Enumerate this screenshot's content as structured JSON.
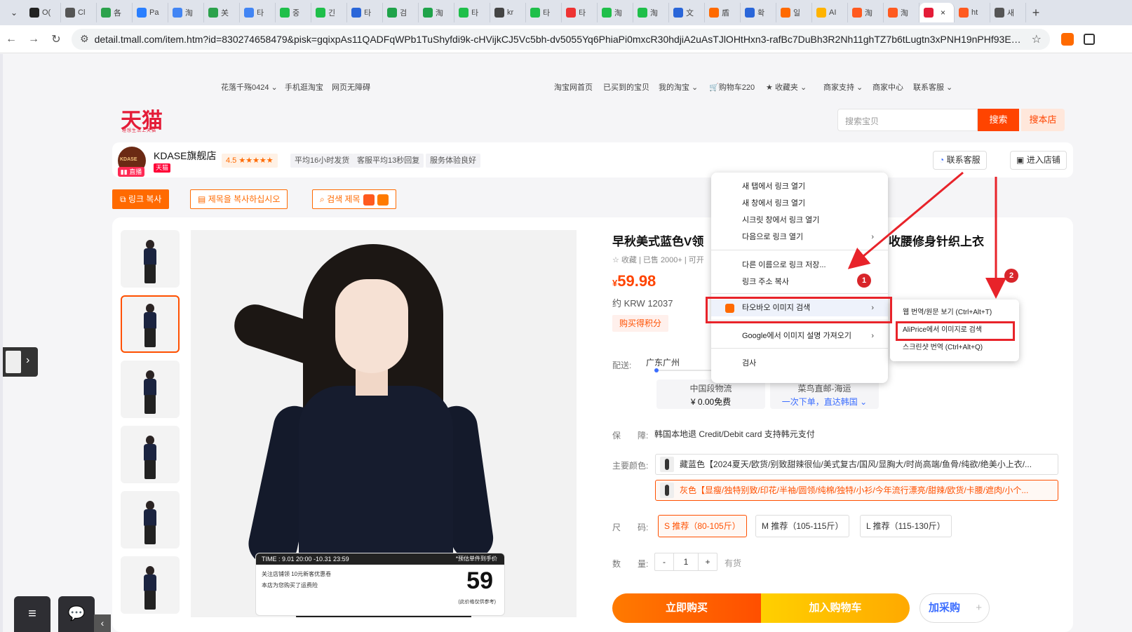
{
  "browser": {
    "tabs": [
      "O(",
      "Cl",
      "各",
      "Pa",
      "淘",
      "关",
      "타",
      "중",
      "긴",
      "타",
      "검",
      "淘",
      "타",
      "kr",
      "타",
      "타",
      "淘",
      "淘",
      "文",
      "盾",
      "확",
      "일",
      "AI",
      "淘",
      "淘",
      "",
      "ht",
      "새"
    ],
    "active_tab_close": "×",
    "new_tab": "+",
    "url": "detail.tmall.com/item.htm?id=830274658479&pisk=gqixpAs11QADFqWPb1TuShyfdi9k-cHVijkCJ5Vc5bh-dv5055Yq6PhiaPi0mxcR30hdjiA2uAsTJlOHtHxn3-rafBc7DuBh3R2Nh11ghTZ7b6tLugtn3xPNH19nPHf93ECAlNNs1ua7CJZ_hZ..."
  },
  "site_nav": {
    "user": "花落千殇0424",
    "mobile": "手机逛淘宝",
    "accessible": "网页无障碍",
    "home": "淘宝网首页",
    "bought": "已买到的宝贝",
    "my_taobao": "我的淘宝",
    "cart": "购物车220",
    "favorites": "收藏夹",
    "merchant_support": "商家支持",
    "merchant_center": "商家中心",
    "customer_service": "联系客服"
  },
  "header": {
    "logo": "天猫",
    "logo_sub": "理想生活上天猫",
    "search_placeholder": "搜索宝贝",
    "search_btn": "搜索",
    "search_store_btn": "搜本店"
  },
  "shop": {
    "avatar_text": "KDASE",
    "live": "直播",
    "name": "KDASE旗舰店",
    "tmall": "天猫",
    "rating": "4.5 ★★★★★",
    "tags": [
      "平均16小时发货",
      "客服平均13秒回复",
      "服务体验良好"
    ],
    "contact": "联系客服",
    "enter": "进入店铺"
  },
  "ext_buttons": {
    "copy_link": "링크 복사",
    "copy_title": "제목을 복사하십시오",
    "search_title": "검색 제목"
  },
  "product": {
    "title": "早秋美式蓝色V领",
    "title_tail": "收腰修身针织上衣",
    "meta": "☆ 收藏 | 已售 2000+ | 可开",
    "price_yen": "¥",
    "price": "59.98",
    "krw": "约 KRW 12037",
    "points": "购买得积分",
    "ship_label": "配送:",
    "ship_loc": "广东广州",
    "ship_cards": [
      {
        "a": "中国段物流",
        "b": "¥ 0.00免费"
      },
      {
        "a": "菜鸟直邮-海运",
        "b": "一次下单，直达韩国 ⌄"
      }
    ],
    "guarantee_label": "保　　障:",
    "guarantee": "韩国本地退 Credit/Debit card 支持韩元支付",
    "color_label": "主要颜色:",
    "colors": [
      "藏蓝色【2024夏天/欧货/别致甜辣很仙/美式复古/国风/显胸大/时尚高端/鱼骨/纯欲/绝美小上衣/...",
      "灰色【显瘦/独特别致/印花/半袖/圆领/纯棉/独特/小衫/今年流行漂亮/甜辣/欧货/卡腰/遮肉/小个..."
    ],
    "size_label": "尺　　码:",
    "sizes": [
      "S 推荐（80-105斤）",
      "M 推荐（105-115斤）",
      "L 推荐（115-130斤）"
    ],
    "qty_label": "数　　量:",
    "qty_minus": "-",
    "qty": "1",
    "qty_plus": "+",
    "stock": "有货",
    "buy_now": "立即购买",
    "add_cart": "加入购物车",
    "add_purchase": "加采购",
    "add_purchase_plus": "+"
  },
  "promo": {
    "time": "TIME : 9.01 20:00 -10.31 23:59",
    "note_top": "*预估单件到手价",
    "line1": "关注店铺领 10元新客优惠卷",
    "line2": "本店为您购买了运费险",
    "price": "59",
    "price_note": "(此价格仅供参考)"
  },
  "context_menu": {
    "items": [
      "새 탭에서 링크 열기",
      "새 창에서 링크 열기",
      "시크릿 창에서 링크 열기",
      "다음으로 링크 열기",
      "다른 이름으로 링크 저장...",
      "링크 주소 복사",
      "타오바오 이미지 검색",
      "Google에서 이미지 설명 가져오기",
      "검사"
    ],
    "chevron": "›"
  },
  "submenu": {
    "items": [
      "웹 번역/원문 보기 (Ctrl+Alt+T)",
      "AliPrice에서 이미지로 검색",
      "스크린샷 번역 (Ctrl+Alt+Q)"
    ]
  },
  "annotations": {
    "badge1": "1",
    "badge2": "2",
    "color": "#e8232a"
  },
  "colors": {
    "tmall_red": "#e41c38",
    "accent_orange": "#ff4400",
    "link_blue": "#3b6dff"
  }
}
